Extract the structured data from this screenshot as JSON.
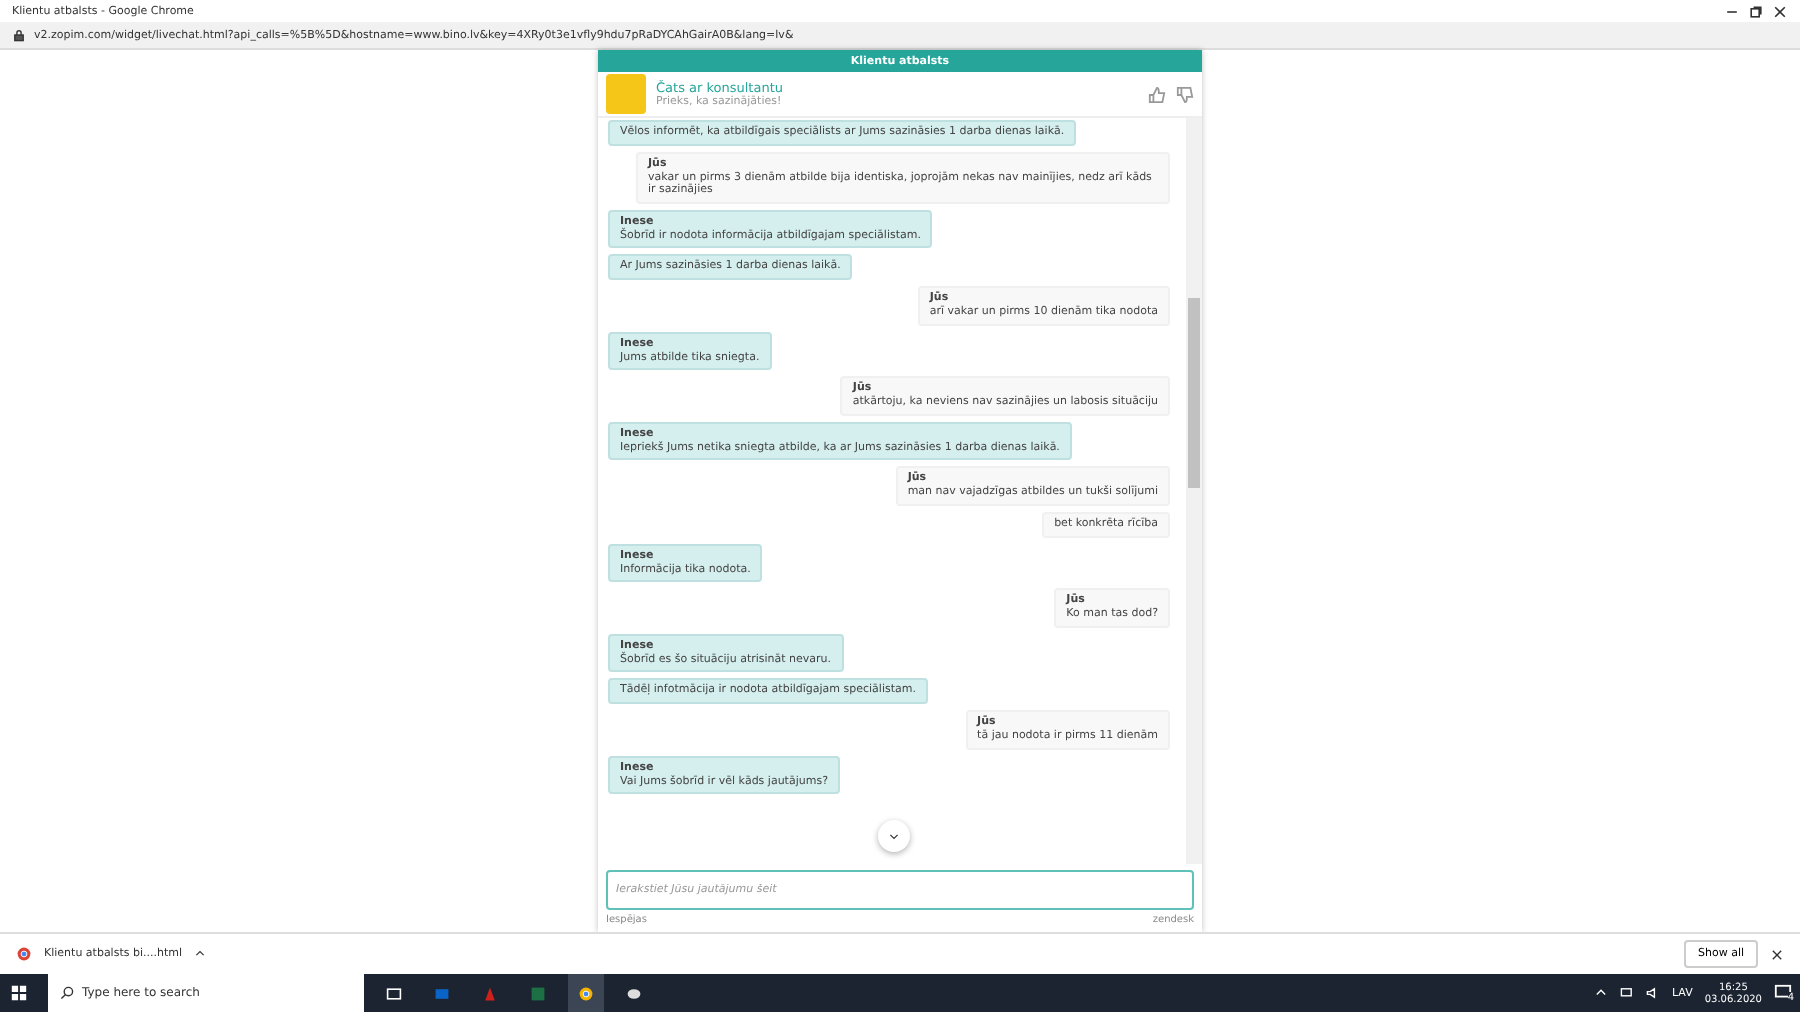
{
  "window": {
    "title": "Klientu atbalsts - Google Chrome",
    "url": "v2.zopim.com/widget/livechat.html?api_calls=%5B%5D&hostname=www.bino.lv&key=4XRy0t3e1vfly9hdu7pRaDYCAhGairA0B&lang=lv&"
  },
  "widget": {
    "title": "Klientu atbalsts",
    "agent_name": "Čats ar konsultantu",
    "greeting": "Prieks, ka sazinājāties!"
  },
  "messages": [
    {
      "kind": "agent",
      "text": "Vēlos informēt, ka atbildīgais speciālists ar Jums sazināsies 1 darba dienas laikā."
    },
    {
      "kind": "visitor",
      "sender": "Jūs",
      "text": "vakar un pirms 3 dienām atbilde bija identiska, joprojām nekas nav mainījies, nedz arī kāds ir sazinājies"
    },
    {
      "kind": "agent",
      "sender": "Inese",
      "text": "Šobrīd ir nodota informācija atbildīgajam speciālistam."
    },
    {
      "kind": "agent",
      "text": "Ar Jums sazināsies 1 darba dienas laikā."
    },
    {
      "kind": "visitor",
      "sender": "Jūs",
      "text": "arī vakar un pirms 10 dienām tika nodota"
    },
    {
      "kind": "agent",
      "sender": "Inese",
      "text": "Jums atbilde tika sniegta."
    },
    {
      "kind": "visitor",
      "sender": "Jūs",
      "text": "atkārtoju, ka neviens nav sazinājies un labosis situāciju"
    },
    {
      "kind": "agent",
      "sender": "Inese",
      "text": "Iepriekš Jums netika sniegta atbilde, ka ar Jums sazināsies 1 darba dienas laikā."
    },
    {
      "kind": "visitor",
      "sender": "Jūs",
      "text": "man nav vajadzīgas atbildes un tukši solījumi"
    },
    {
      "kind": "visitor",
      "text": "bet konkrēta rīcība"
    },
    {
      "kind": "agent",
      "sender": "Inese",
      "text": "Informācija tika nodota."
    },
    {
      "kind": "visitor",
      "sender": "Jūs",
      "text": "Ko man tas dod?"
    },
    {
      "kind": "agent",
      "sender": "Inese",
      "text": "Šobrīd es šo situāciju atrisināt nevaru."
    },
    {
      "kind": "agent",
      "text": "Tādēļ infotmācija ir nodota atbildīgajam speciālistam."
    },
    {
      "kind": "visitor",
      "sender": "Jūs",
      "text": "tā jau nodota ir pirms 11 dienām"
    },
    {
      "kind": "agent",
      "sender": "Inese",
      "text": "Vai Jums šobrīd ir vēl kāds jautājums?"
    }
  ],
  "input": {
    "placeholder": "Ierakstiet Jūsu jautājumu šeit"
  },
  "footer": {
    "options": "Iespējas",
    "brand": "zendesk"
  },
  "downloads": {
    "file": "Klientu atbalsts bi....html",
    "show_all": "Show all"
  },
  "taskbar": {
    "search_placeholder": "Type here to search",
    "language": "LAV",
    "time": "16:25",
    "date": "03.06.2020",
    "notifications": "4"
  }
}
